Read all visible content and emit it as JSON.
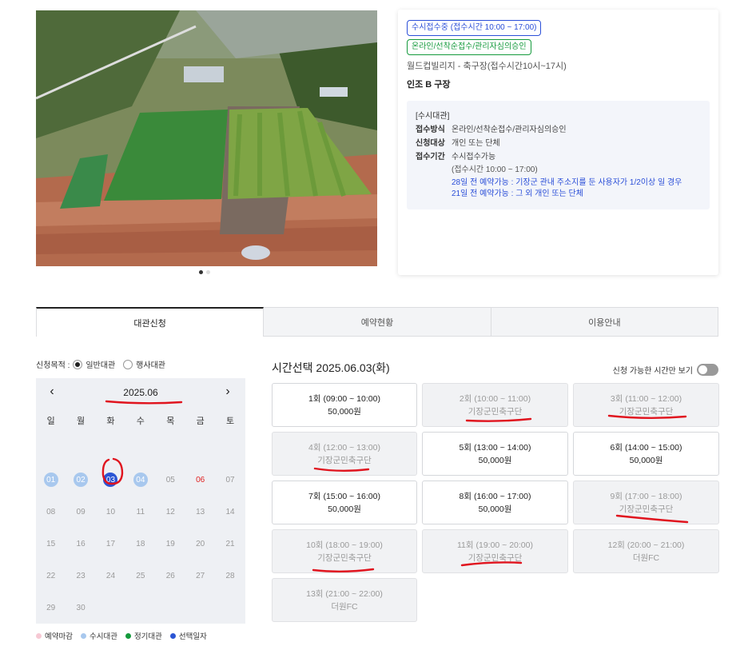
{
  "gallery": {
    "active_index": 0,
    "count": 2
  },
  "info": {
    "badges": [
      "수시접수중 (접수시간 10:00 ~ 17:00)",
      "온라인/선착순접수/관리자심의승인"
    ],
    "facility": "월드컵빌리지 - 축구장(접수시간10시~17시)",
    "court": "인조 B 구장",
    "detail_head": "[수시대관]",
    "method_label": "접수방식",
    "method_value": "온라인/선착순접수/관리자심의승인",
    "target_label": "신청대상",
    "target_value": "개인 또는 단체",
    "period_label": "접수기간",
    "period_value": "수시접수가능",
    "period_sub": "(접수시간 10:00 ~ 17:00)",
    "note1": "28일 전 예약가능 : 기장군 관내 주소지를 둔 사용자가 1/2이상 일 경우",
    "note2": "21일 전 예약가능 : 그 외 개인 또는 단체"
  },
  "tabs": [
    "대관신청",
    "예약현황",
    "이용안내"
  ],
  "purpose": {
    "label": "신청목적 :",
    "option1": "일반대관",
    "option2": "행사대관"
  },
  "calendar": {
    "month": "2025.06",
    "prev": "‹",
    "next": "›",
    "weekdays": [
      "일",
      "월",
      "화",
      "수",
      "목",
      "금",
      "토"
    ],
    "weeks": [
      [
        "",
        "",
        "",
        "",
        "",
        "",
        ""
      ],
      [
        "01",
        "02",
        "03",
        "04",
        "05",
        "06",
        "07"
      ],
      [
        "08",
        "09",
        "10",
        "11",
        "12",
        "13",
        "14"
      ],
      [
        "15",
        "16",
        "17",
        "18",
        "19",
        "20",
        "21"
      ],
      [
        "22",
        "23",
        "24",
        "25",
        "26",
        "27",
        "28"
      ],
      [
        "29",
        "30",
        "",
        "",
        "",
        "",
        ""
      ]
    ],
    "available": [
      "01",
      "02",
      "04"
    ],
    "selected": "03",
    "red_days": [
      "06"
    ]
  },
  "legend": [
    {
      "label": "예약마감",
      "color": "#f6c9d4"
    },
    {
      "label": "수시대관",
      "color": "#a8c8ee"
    },
    {
      "label": "정기대관",
      "color": "#149a3c"
    },
    {
      "label": "선택일자",
      "color": "#2b55d4"
    }
  ],
  "time_title": "시간선택 2025.06.03(화)",
  "toggle_label": "신청 가능한 시간만 보기",
  "slots": [
    {
      "time": "1회 (09:00 ~ 10:00)",
      "sub": "50,000원",
      "taken": false
    },
    {
      "time": "2회 (10:00 ~ 11:00)",
      "sub": "기장군민축구단",
      "taken": true
    },
    {
      "time": "3회 (11:00 ~ 12:00)",
      "sub": "기장군민축구단",
      "taken": true
    },
    {
      "time": "4회 (12:00 ~ 13:00)",
      "sub": "기장군민축구단",
      "taken": true
    },
    {
      "time": "5회 (13:00 ~ 14:00)",
      "sub": "50,000원",
      "taken": false
    },
    {
      "time": "6회 (14:00 ~ 15:00)",
      "sub": "50,000원",
      "taken": false
    },
    {
      "time": "7회 (15:00 ~ 16:00)",
      "sub": "50,000원",
      "taken": false
    },
    {
      "time": "8회 (16:00 ~ 17:00)",
      "sub": "50,000원",
      "taken": false
    },
    {
      "time": "9회 (17:00 ~ 18:00)",
      "sub": "기장군민축구단",
      "taken": true
    },
    {
      "time": "10회 (18:00 ~ 19:00)",
      "sub": "기장군민축구단",
      "taken": true
    },
    {
      "time": "11회 (19:00 ~ 20:00)",
      "sub": "기장군민축구단",
      "taken": true
    },
    {
      "time": "12회 (20:00 ~ 21:00)",
      "sub": "더원FC",
      "taken": true
    },
    {
      "time": "13회 (21:00 ~ 22:00)",
      "sub": "더원FC",
      "taken": true
    }
  ]
}
